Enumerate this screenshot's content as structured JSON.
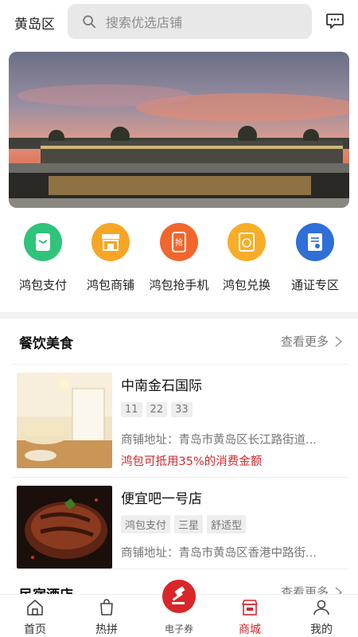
{
  "header": {
    "city": "黄岛区",
    "search_placeholder": "搜索优选店铺"
  },
  "quick_menu": [
    {
      "label": "鸿包支付",
      "color": "#2fc47a",
      "icon": "wallet-icon"
    },
    {
      "label": "鸿包商铺",
      "color": "#f7a526",
      "icon": "store-icon"
    },
    {
      "label": "鸿包抢手机",
      "color": "#f2662d",
      "icon": "phone-icon"
    },
    {
      "label": "鸿包兑换",
      "color": "#f7ad28",
      "icon": "exchange-icon"
    },
    {
      "label": "通证专区",
      "color": "#2e6fd8",
      "icon": "certificate-icon"
    }
  ],
  "section_food": {
    "title": "餐饮美食",
    "more": "查看更多"
  },
  "shops": [
    {
      "name": "中南金石国际",
      "tags": [
        "11",
        "22",
        "33"
      ],
      "address": "商铺地址：青岛市黄岛区长江路街道...",
      "promo": "鸿包可抵用35%的消费金额"
    },
    {
      "name": "便宜吧一号店",
      "tags": [
        "鸿包支付",
        "三星",
        "舒适型"
      ],
      "address": "商铺地址：青岛市黄岛区香港中路街..."
    }
  ],
  "section_hotel": {
    "title": "民宿酒店",
    "more": "查看更多"
  },
  "tabbar": {
    "home": "首页",
    "hot": "热拼",
    "coupon": "电子券",
    "mall": "商城",
    "mine": "我的"
  },
  "colors": {
    "accent": "#d9262a"
  }
}
